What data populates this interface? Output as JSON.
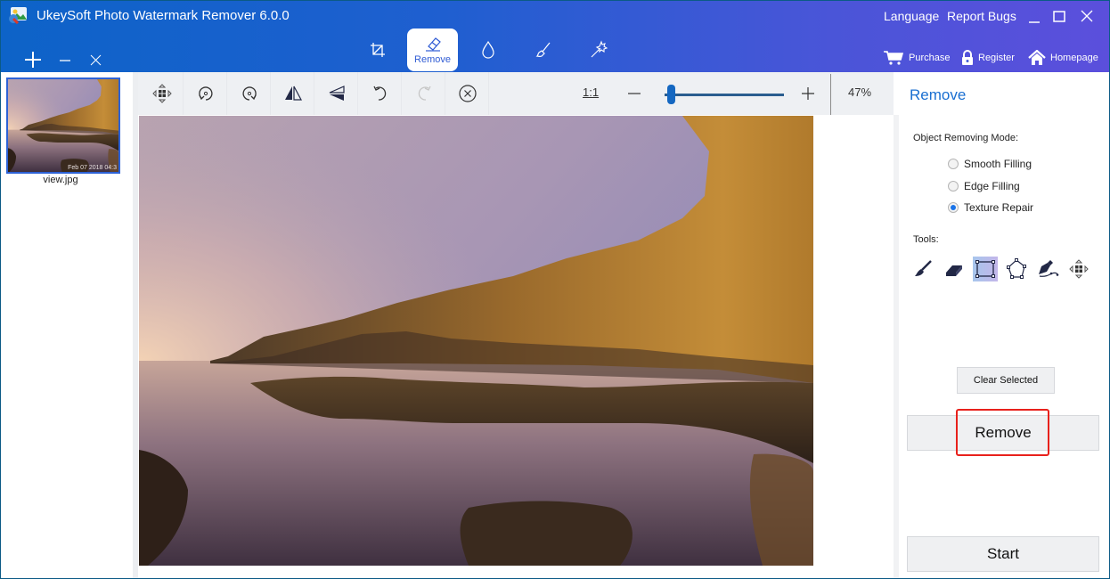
{
  "app": {
    "title": "UkeySoft Photo Watermark Remover 6.0.0"
  },
  "header": {
    "links": {
      "language": "Language",
      "report_bugs": "Report Bugs"
    },
    "window_controls": [
      "minimize-icon",
      "maximize-icon",
      "close-icon"
    ],
    "file_controls": [
      "add-icon",
      "remove-icon",
      "clear-icon"
    ],
    "tool_tabs": [
      {
        "id": "crop",
        "icon": "crop-icon",
        "label": ""
      },
      {
        "id": "remove",
        "icon": "eraser-icon",
        "label": "Remove",
        "active": true
      },
      {
        "id": "blur",
        "icon": "drop-icon",
        "label": ""
      },
      {
        "id": "brush",
        "icon": "brush-icon",
        "label": ""
      },
      {
        "id": "magic",
        "icon": "magic-wand-icon",
        "label": ""
      }
    ],
    "actions": {
      "purchase": "Purchase",
      "register": "Register",
      "homepage": "Homepage"
    }
  },
  "file_list": {
    "items": [
      {
        "name": "view.jpg",
        "date_overlay": "Feb 07 2018 04:3",
        "selected": true
      }
    ]
  },
  "toolbar": {
    "buttons": [
      "move-icon",
      "rotate-left-icon",
      "rotate-right-icon",
      "flip-horizontal-icon",
      "flip-vertical-icon",
      "undo-icon",
      "redo-icon",
      "cancel-icon"
    ],
    "actual_size_label": "1:1",
    "zoom_percent": "47%",
    "zoom_slider_fraction": 0.05
  },
  "right_panel": {
    "title": "Remove",
    "mode_label": "Object Removing Mode:",
    "modes": [
      {
        "label": "Smooth Filling",
        "checked": false
      },
      {
        "label": "Edge Filling",
        "checked": false
      },
      {
        "label": "Texture Repair",
        "checked": true
      }
    ],
    "tools_label": "Tools:",
    "tools": [
      {
        "icon": "brush-tool-icon",
        "active": false
      },
      {
        "icon": "eraser-tool-icon",
        "active": false
      },
      {
        "icon": "rectangle-select-icon",
        "active": true
      },
      {
        "icon": "polygon-select-icon",
        "active": false
      },
      {
        "icon": "pen-lasso-icon",
        "active": false
      },
      {
        "icon": "move-tool-icon",
        "active": false
      }
    ],
    "clear_selected_label": "Clear Selected",
    "remove_label": "Remove",
    "start_label": "Start"
  },
  "colors": {
    "header_start": "#0d63c8",
    "header_end": "#5b4fdc",
    "accent": "#1a6fd1",
    "highlight": "#e8211c"
  }
}
